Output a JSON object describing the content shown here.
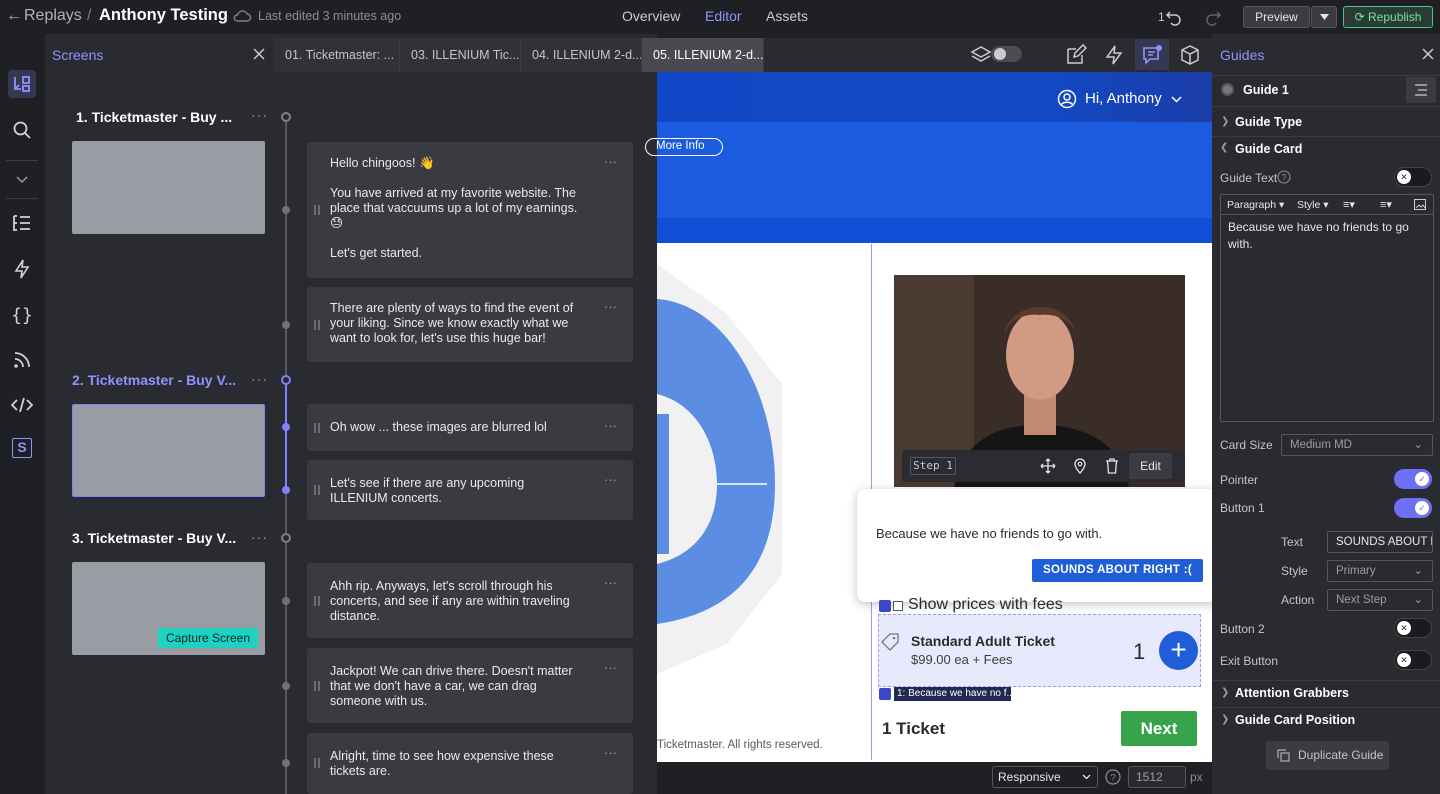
{
  "header": {
    "breadcrumb_root": "Replays",
    "breadcrumb_sep": "/",
    "title": "Anthony Testing",
    "edited": "Last edited 3 minutes ago",
    "tabs": [
      "Overview",
      "Editor",
      "Assets"
    ],
    "undo_count": "1",
    "preview_label": "Preview",
    "republish_label": "Republish"
  },
  "screens_panel": {
    "title": "Screens",
    "screens": [
      {
        "name": "1. Ticketmaster - Buy ..."
      },
      {
        "name": "2. Ticketmaster - Buy V..."
      },
      {
        "name": "3. Ticketmaster - Buy V..."
      }
    ],
    "capture_label": "Capture Screen",
    "cards": [
      "Hello chingoos! 👋\n\nYou have arrived at my favorite website. The place that vaccuums up a lot of my earnings. 😓\n\nLet's get started.",
      "There are plenty of ways to find the event of your liking. Since we know exactly what we want to look for, let's use this huge bar!",
      "Oh wow ... these images are blurred lol",
      "Let's see if there are any upcoming ILLENIUM concerts.",
      "Ahh rip. Anyways, let's scroll through his concerts, and see if any are within traveling distance.",
      "Jackpot! We can drive there. Doesn't matter that we don't have a car, we can drag someone with us.",
      "Alright, time to see how expensive these tickets are."
    ]
  },
  "screen_tabs": [
    "01. Ticketmaster: ...",
    "03. ILLENIUM Tic...",
    "04. ILLENIUM 2-d...",
    "05. ILLENIUM 2-d..."
  ],
  "canvas": {
    "greeting": "Hi, Anthony",
    "more_info": "More Info",
    "step_label": "Step 1",
    "edit_label": "Edit",
    "popup_text": "Because we have no friends to go with.",
    "popup_button": "SOUNDS ABOUT RIGHT :(",
    "show_prices": "Show prices with fees",
    "ticket_name": "Standard Adult Ticket",
    "ticket_price": "$99.00 ea + Fees",
    "ticket_qty": "1",
    "guide_label": "1: Because we have no f...",
    "ticket_count": "1 Ticket",
    "next_label": "Next",
    "copyright": "Ticketmaster. All rights reserved."
  },
  "bottom": {
    "responsive": "Responsive",
    "width": "1512",
    "unit": "px"
  },
  "guides": {
    "title": "Guides",
    "guide_name": "Guide 1",
    "guide_type": "Guide Type",
    "guide_card": "Guide Card",
    "guide_text_label": "Guide Text",
    "toolbar_paragraph": "Paragraph",
    "toolbar_style": "Style",
    "editor_text": "Because we have no friends to go with.",
    "card_size_label": "Card Size",
    "card_size_value": "Medium MD",
    "pointer_label": "Pointer",
    "button1_label": "Button 1",
    "text_label": "Text",
    "text_value": "SOUNDS ABOUT RIGHT :(",
    "style_label": "Style",
    "style_value": "Primary",
    "action_label": "Action",
    "action_value": "Next Step",
    "button2_label": "Button 2",
    "exit_label": "Exit Button",
    "attention": "Attention Grabbers",
    "position": "Guide Card Position",
    "duplicate": "Duplicate Guide"
  }
}
